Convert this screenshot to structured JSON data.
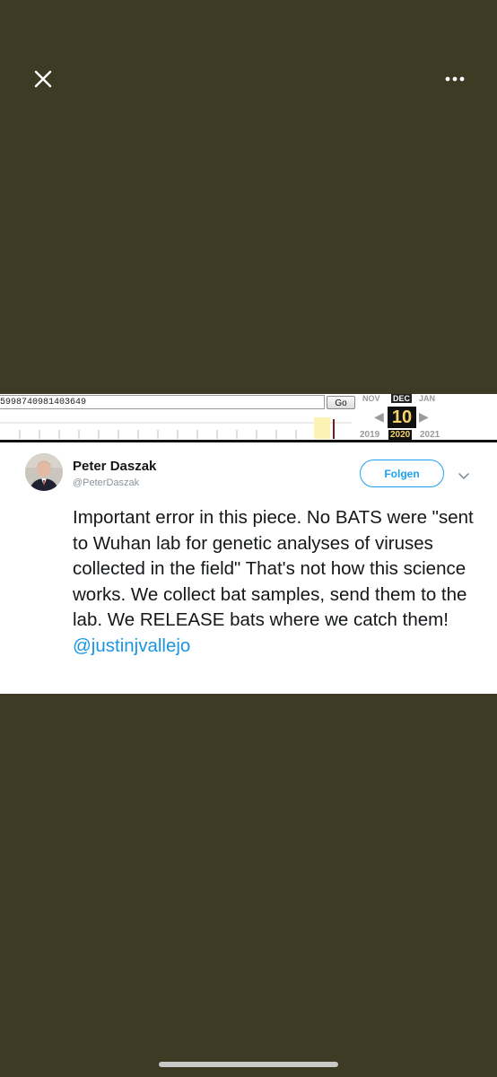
{
  "wayback": {
    "url": "5998740981403649",
    "go_label": "Go",
    "months": [
      "NOV",
      "DEC",
      "JAN"
    ],
    "day": "10",
    "years": [
      "2019",
      "2020",
      "2021"
    ],
    "current_month": "DEC",
    "current_year": "2020"
  },
  "tweet": {
    "name": "Peter Daszak",
    "handle": "@PeterDaszak",
    "follow_label": "Folgen",
    "body_text": "Important error in this piece. No BATS were \"sent to Wuhan lab for genetic analyses of viruses collected in the field\" That's not how this science works. We collect bat samples, send them to the lab. We RELEASE bats where we catch them! ",
    "mention": "@justinjvallejo"
  },
  "icons": {
    "close": "close-icon",
    "more": "more-horizontal-icon",
    "caret": "chevron-down-icon"
  },
  "colors": {
    "background": "#3d3b24",
    "tweet_blue": "#1da1f2",
    "mention_blue": "#1b95e0",
    "wayback_highlight": "#f5d36a"
  }
}
